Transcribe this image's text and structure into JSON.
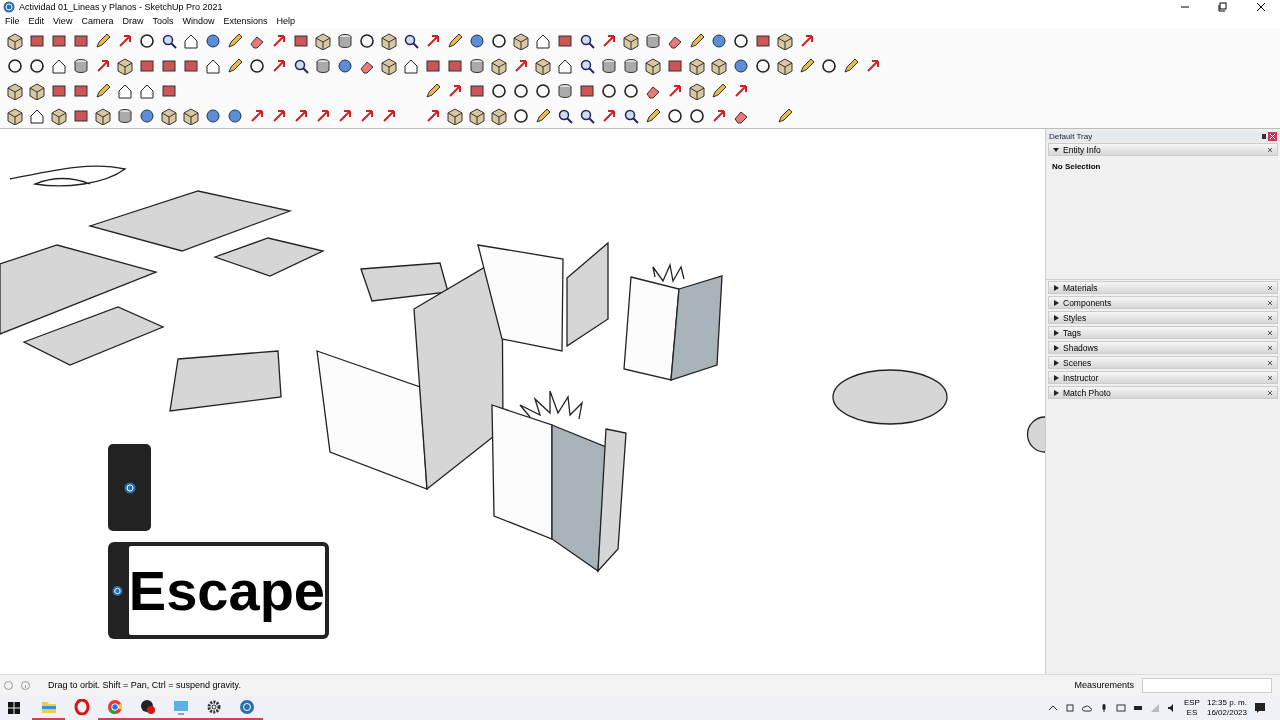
{
  "window": {
    "title": "Actividad 01_Lineas y Planos - SketchUp Pro 2021"
  },
  "menu": [
    "File",
    "Edit",
    "View",
    "Camera",
    "Draw",
    "Tools",
    "Window",
    "Extensions",
    "Help"
  ],
  "viewport": {
    "key_overlay": {
      "label": "Escape"
    }
  },
  "tray": {
    "title": "Default Tray",
    "panels": [
      {
        "label": "Entity Info",
        "expanded": true,
        "content": "No Selection"
      },
      {
        "label": "Materials",
        "expanded": false
      },
      {
        "label": "Components",
        "expanded": false
      },
      {
        "label": "Styles",
        "expanded": false
      },
      {
        "label": "Tags",
        "expanded": false
      },
      {
        "label": "Shadows",
        "expanded": false
      },
      {
        "label": "Scenes",
        "expanded": false
      },
      {
        "label": "Instructor",
        "expanded": false
      },
      {
        "label": "Match Photo",
        "expanded": false
      }
    ]
  },
  "status_bar": {
    "hint": "Drag to orbit. Shift = Pan, Ctrl = suspend gravity.",
    "measurements_label": "Measurements"
  },
  "taskbar": {
    "apps": [
      {
        "kind": "folder",
        "running": true
      },
      {
        "kind": "opera",
        "running": false
      },
      {
        "kind": "chrome",
        "running": true
      },
      {
        "kind": "record",
        "running": true
      },
      {
        "kind": "remote",
        "running": true
      },
      {
        "kind": "gear",
        "running": true
      },
      {
        "kind": "sketchup",
        "running": true
      }
    ],
    "language": "ESP",
    "layout": "ES",
    "time": "12:35 p. m.",
    "date": "16/02/2023"
  }
}
